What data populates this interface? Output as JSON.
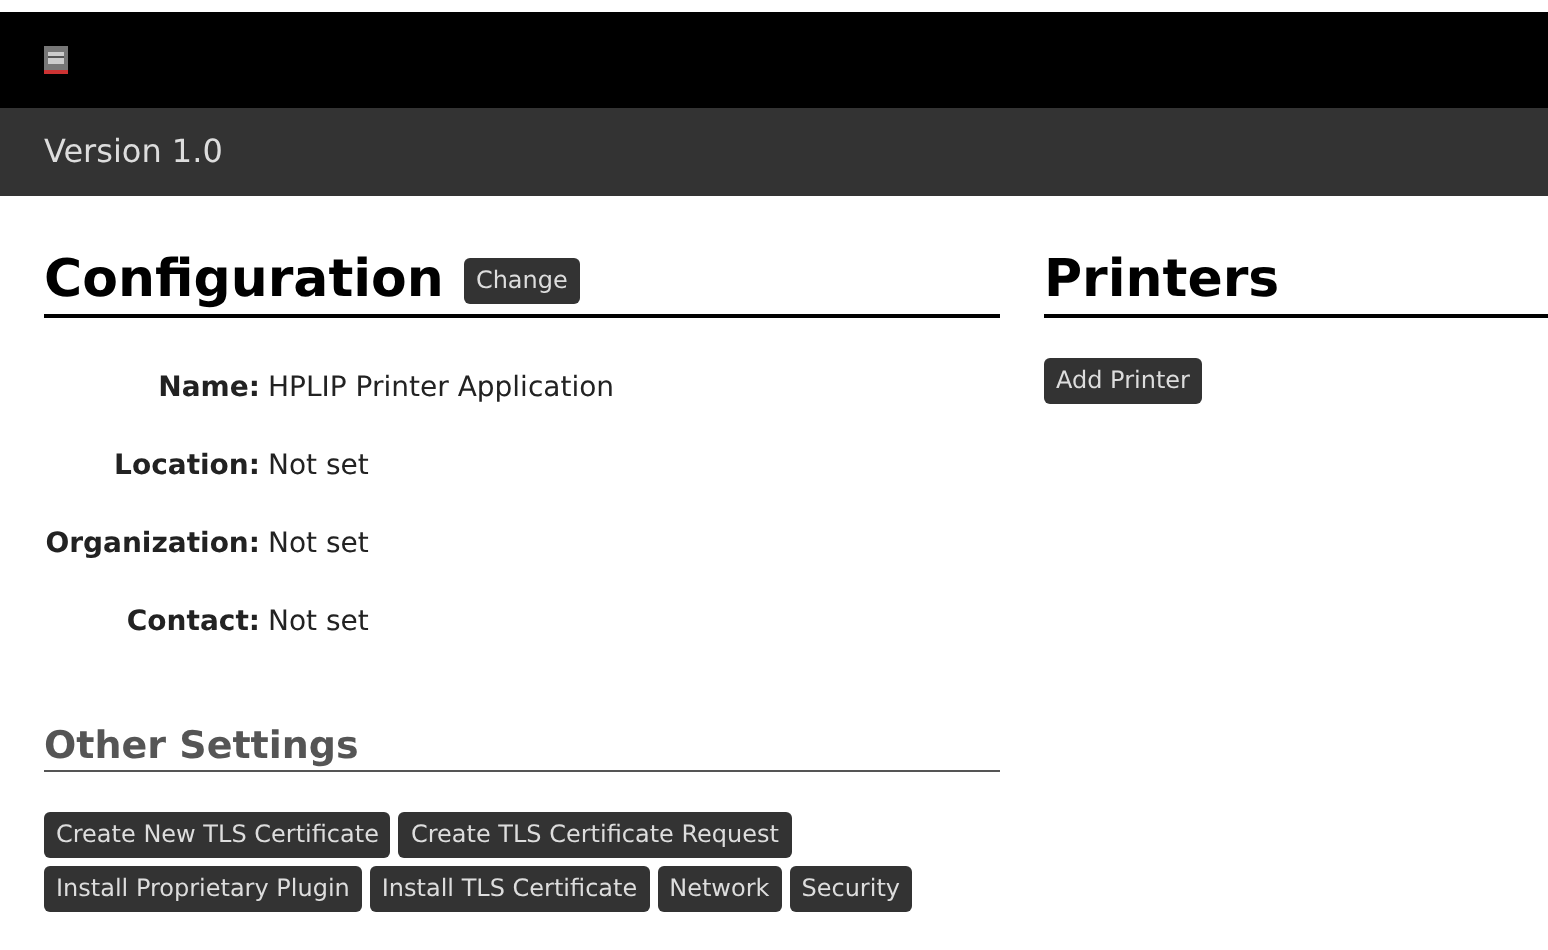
{
  "header": {
    "version": "Version 1.0"
  },
  "configuration": {
    "title": "Configuration",
    "change_button": "Change",
    "fields": [
      {
        "label": "Name:",
        "value": "HPLIP Printer Application"
      },
      {
        "label": "Location:",
        "value": "Not set"
      },
      {
        "label": "Organization:",
        "value": "Not set"
      },
      {
        "label": "Contact:",
        "value": "Not set"
      }
    ]
  },
  "other_settings": {
    "title": "Other Settings",
    "button_rows": [
      [
        "Create New TLS Certificate",
        "Create TLS Certificate Request"
      ],
      [
        "Install Proprietary Plugin",
        "Install TLS Certificate",
        "Network",
        "Security"
      ]
    ]
  },
  "printers": {
    "title": "Printers",
    "add_button": "Add Printer"
  }
}
